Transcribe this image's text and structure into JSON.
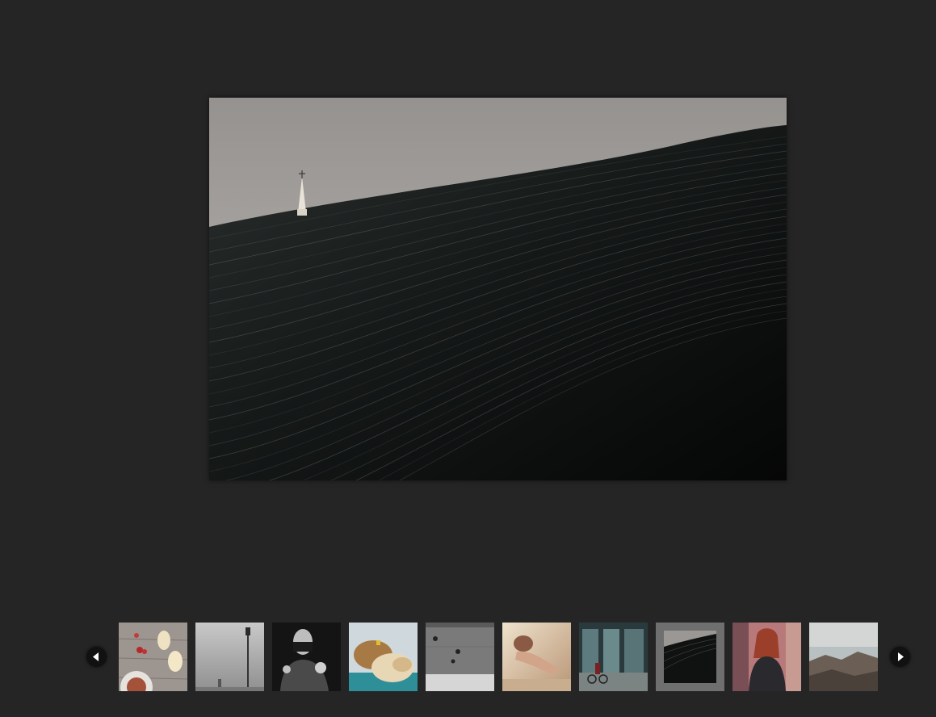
{
  "gallery": {
    "main_image": {
      "description_icon": "photo-steeple-curve",
      "sky_color": "#a9a5a2",
      "wave_color": "#101312"
    },
    "nav": {
      "prev_icon": "chevron-left-icon",
      "next_icon": "chevron-right-icon"
    },
    "thumbnails": [
      {
        "id": "table-still-life",
        "icon": "photo-table-still-life"
      },
      {
        "id": "foggy-lamppost",
        "icon": "photo-foggy-lamppost"
      },
      {
        "id": "masked-figure",
        "icon": "photo-masked-figure"
      },
      {
        "id": "sheep",
        "icon": "photo-sheep"
      },
      {
        "id": "aerial-street",
        "icon": "photo-aerial-street"
      },
      {
        "id": "reclining-figure",
        "icon": "photo-reclining-figure"
      },
      {
        "id": "cyclist-storefront",
        "icon": "photo-cyclist-storefront"
      },
      {
        "id": "steeple-curve",
        "icon": "photo-steeple-curve",
        "active": true
      },
      {
        "id": "woman-portrait",
        "icon": "photo-woman-portrait"
      },
      {
        "id": "rocky-coast",
        "icon": "photo-rocky-coast"
      }
    ]
  }
}
